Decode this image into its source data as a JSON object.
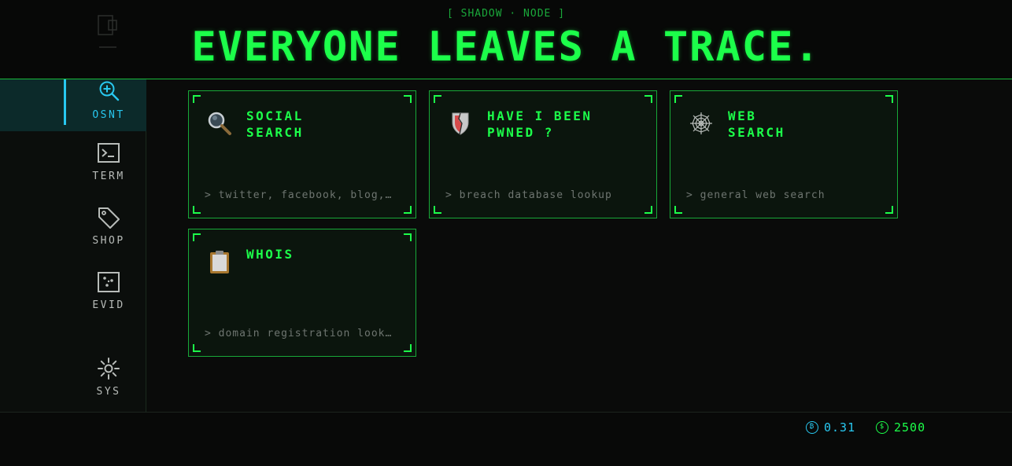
{
  "header": {
    "subtitle": "[ SHADOW · NODE ]",
    "title": "EVERYONE LEAVES A TRACE."
  },
  "sidebar": {
    "items": [
      {
        "label": "OSNT",
        "icon": "search-plus-icon",
        "active": true
      },
      {
        "label": "TERM",
        "icon": "terminal-icon",
        "active": false
      },
      {
        "label": "SHOP",
        "icon": "tag-icon",
        "active": false
      },
      {
        "label": "EVID",
        "icon": "evidence-board-icon",
        "active": false
      },
      {
        "label": "SYS",
        "icon": "gear-icon",
        "active": false
      }
    ]
  },
  "tools": [
    {
      "title": "SOCIAL\nSEARCH",
      "desc": "> twitter, facebook, blog, forum",
      "icon": "magnifier-icon"
    },
    {
      "title": "HAVE I BEEN\nPWNED ?",
      "desc": "> breach database lookup",
      "icon": "broken-shield-icon"
    },
    {
      "title": "WEB\nSEARCH",
      "desc": "> general web search",
      "icon": "spider-web-icon"
    },
    {
      "title": "WHOIS",
      "desc": "> domain registration lookup",
      "icon": "clipboard-icon"
    }
  ],
  "footer": {
    "btc_symbol": "₿",
    "btc_balance": "0.31",
    "cash_symbol": "$",
    "cash_balance": "2500"
  },
  "colors": {
    "accent_green": "#1cff4a",
    "accent_cyan": "#28c8f0",
    "background": "#0a0b0a"
  }
}
